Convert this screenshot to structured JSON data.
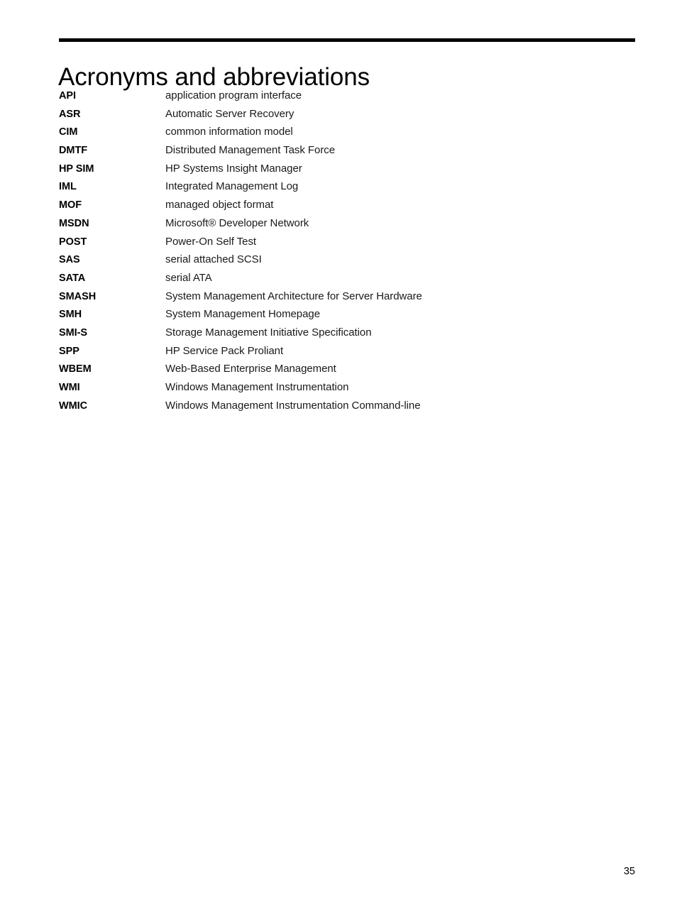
{
  "document": {
    "title": "Acronyms and abbreviations",
    "page_number": "35",
    "rule_color": "#000000"
  },
  "glossary": {
    "entries": [
      {
        "term": "API",
        "definition": "application program interface"
      },
      {
        "term": "ASR",
        "definition": "Automatic Server Recovery"
      },
      {
        "term": "CIM",
        "definition": "common information model"
      },
      {
        "term": "DMTF",
        "definition": "Distributed Management Task Force"
      },
      {
        "term": "HP SIM",
        "definition": "HP Systems Insight Manager"
      },
      {
        "term": "IML",
        "definition": "Integrated Management Log"
      },
      {
        "term": "MOF",
        "definition": "managed object format"
      },
      {
        "term": "MSDN",
        "definition": "Microsoft® Developer Network"
      },
      {
        "term": "POST",
        "definition": "Power-On Self Test"
      },
      {
        "term": "SAS",
        "definition": "serial attached SCSI"
      },
      {
        "term": "SATA",
        "definition": "serial ATA"
      },
      {
        "term": "SMASH",
        "definition": "System Management Architecture for Server Hardware"
      },
      {
        "term": "SMH",
        "definition": "System Management Homepage"
      },
      {
        "term": "SMI-S",
        "definition": "Storage Management Initiative Specification"
      },
      {
        "term": "SPP",
        "definition": "HP Service Pack Proliant"
      },
      {
        "term": "WBEM",
        "definition": "Web-Based Enterprise Management"
      },
      {
        "term": "WMI",
        "definition": "Windows Management Instrumentation"
      },
      {
        "term": "WMIC",
        "definition": "Windows Management Instrumentation Command-line"
      }
    ]
  }
}
